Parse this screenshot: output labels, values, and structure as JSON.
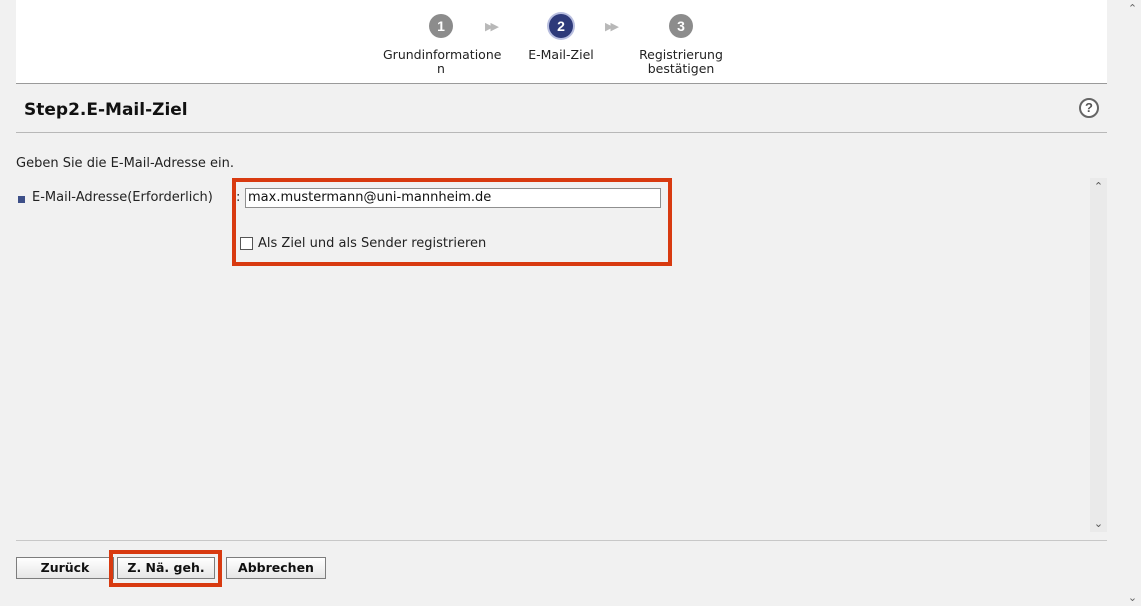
{
  "steps": [
    {
      "number": "1",
      "label": "Grundinformatione\nn",
      "state": "inactive"
    },
    {
      "number": "2",
      "label": "E-Mail-Ziel",
      "state": "active"
    },
    {
      "number": "3",
      "label": "Registrierung\nbestätigen",
      "state": "inactive"
    }
  ],
  "step_arrow": "▶▶",
  "title": "Step2.E-Mail-Ziel",
  "help_icon": "?",
  "instruction": "Geben Sie die E-Mail-Adresse ein.",
  "form": {
    "email_label": "E-Mail-Adresse(Erforderlich)",
    "colon": ":",
    "email_value": "max.mustermann@uni-mannheim.de",
    "checkbox_label": "Als Ziel und als Sender registrieren",
    "checkbox_checked": false
  },
  "buttons": {
    "back": "Zurück",
    "next": "Z. Nä. geh.",
    "cancel": "Abbrechen"
  },
  "colors": {
    "highlight": "#d83a10",
    "active_step": "#2e3a7a",
    "inactive_step": "#8c8c8c"
  }
}
